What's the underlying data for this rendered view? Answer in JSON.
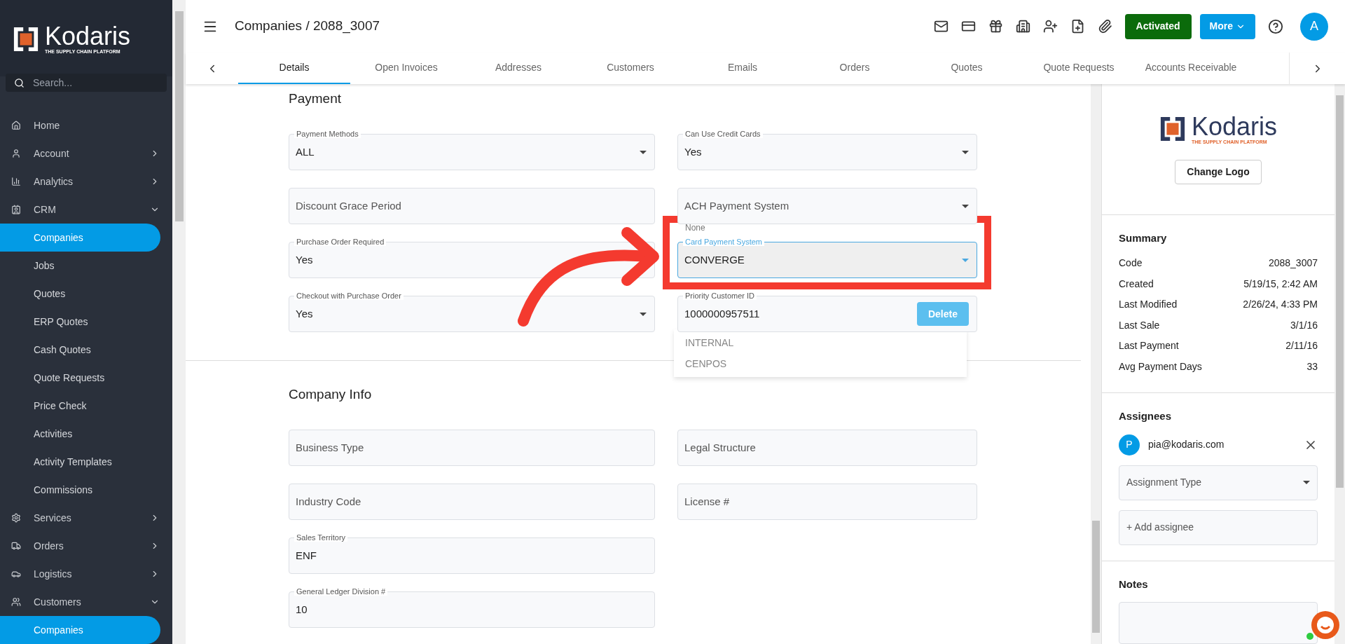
{
  "sidebar": {
    "logo_text": "Kodaris",
    "logo_tagline": "THE SUPPLY CHAIN PLATFORM",
    "search_placeholder": "Search...",
    "items": [
      {
        "label": "Home",
        "kind": "link"
      },
      {
        "label": "Account",
        "kind": "group",
        "expanded": false
      },
      {
        "label": "Analytics",
        "kind": "group",
        "expanded": false
      },
      {
        "label": "CRM",
        "kind": "group",
        "expanded": true,
        "children": [
          {
            "label": "Companies",
            "selected": true
          },
          {
            "label": "Jobs",
            "selected": false
          },
          {
            "label": "Quotes",
            "selected": false
          },
          {
            "label": "ERP Quotes",
            "selected": false
          },
          {
            "label": "Cash Quotes",
            "selected": false
          },
          {
            "label": "Quote Requests",
            "selected": false
          },
          {
            "label": "Price Check",
            "selected": false
          },
          {
            "label": "Activities",
            "selected": false
          },
          {
            "label": "Activity Templates",
            "selected": false
          },
          {
            "label": "Commissions",
            "selected": false
          }
        ]
      },
      {
        "label": "Services",
        "kind": "group",
        "expanded": false
      },
      {
        "label": "Orders",
        "kind": "group",
        "expanded": false
      },
      {
        "label": "Logistics",
        "kind": "group",
        "expanded": false
      },
      {
        "label": "Customers",
        "kind": "group",
        "expanded": true,
        "children": [
          {
            "label": "Companies",
            "selected": true
          }
        ]
      }
    ]
  },
  "header": {
    "title": "Companies / 2088_3007",
    "status": "Activated",
    "more": "More",
    "avatar": "A"
  },
  "tabs": [
    {
      "label": "Details",
      "selected": true
    },
    {
      "label": "Open Invoices",
      "selected": false
    },
    {
      "label": "Addresses",
      "selected": false
    },
    {
      "label": "Customers",
      "selected": false
    },
    {
      "label": "Emails",
      "selected": false
    },
    {
      "label": "Orders",
      "selected": false
    },
    {
      "label": "Quotes",
      "selected": false
    },
    {
      "label": "Quote Requests",
      "selected": false
    },
    {
      "label": "Accounts Receivable",
      "selected": false
    }
  ],
  "payment": {
    "title": "Payment",
    "fields": [
      {
        "kind": "select",
        "label": "Payment Methods",
        "value": "ALL"
      },
      {
        "kind": "select",
        "label": "Can Use Credit Cards",
        "value": "Yes"
      },
      {
        "kind": "text",
        "placeholder": "Discount Grace Period"
      },
      {
        "kind": "select",
        "placeholder": "ACH Payment System"
      },
      {
        "kind": "select",
        "label": "Purchase Order Required",
        "value": "Yes"
      },
      {
        "kind": "select",
        "label": "Card Payment System",
        "value": "CONVERGE",
        "focused": true
      },
      {
        "kind": "select",
        "label": "Checkout with Purchase Order",
        "value": "Yes"
      },
      {
        "kind": "action",
        "label": "Priority Customer ID",
        "value": "1000000957511",
        "action": "Delete"
      }
    ],
    "menu_options": [
      {
        "label": "None"
      },
      {
        "label": "INTERNAL"
      },
      {
        "label": "CENPOS"
      }
    ]
  },
  "company_info": {
    "title": "Company Info",
    "fields": [
      {
        "kind": "text",
        "placeholder": "Business Type"
      },
      {
        "kind": "text",
        "placeholder": "Legal Structure"
      },
      {
        "kind": "text",
        "placeholder": "Industry Code"
      },
      {
        "kind": "text",
        "placeholder": "License #"
      },
      {
        "kind": "text",
        "label": "Sales Territory",
        "value": "ENF"
      },
      {
        "kind": "empty"
      },
      {
        "kind": "text",
        "label": "General Ledger Division #",
        "value": "10"
      }
    ]
  },
  "right_panel": {
    "logo_text": "Kodaris",
    "logo_tagline": "THE SUPPLY CHAIN PLATFORM",
    "change_logo": "Change Logo",
    "summary_title": "Summary",
    "summary": [
      {
        "label": "Code",
        "value": "2088_3007"
      },
      {
        "label": "Created",
        "value": "5/19/15, 2:42 AM"
      },
      {
        "label": "Last Modified",
        "value": "2/26/24, 4:33 PM"
      },
      {
        "label": "Last Sale",
        "value": "3/1/16"
      },
      {
        "label": "Last Payment",
        "value": "2/11/16"
      },
      {
        "label": "Avg Payment Days",
        "value": "33"
      }
    ],
    "assignees_title": "Assignees",
    "assignees": [
      {
        "initial": "P",
        "email": "pia@kodaris.com"
      }
    ],
    "assignment_type_placeholder": "Assignment Type",
    "add_assignee_placeholder": "+ Add assignee",
    "notes_title": "Notes"
  }
}
